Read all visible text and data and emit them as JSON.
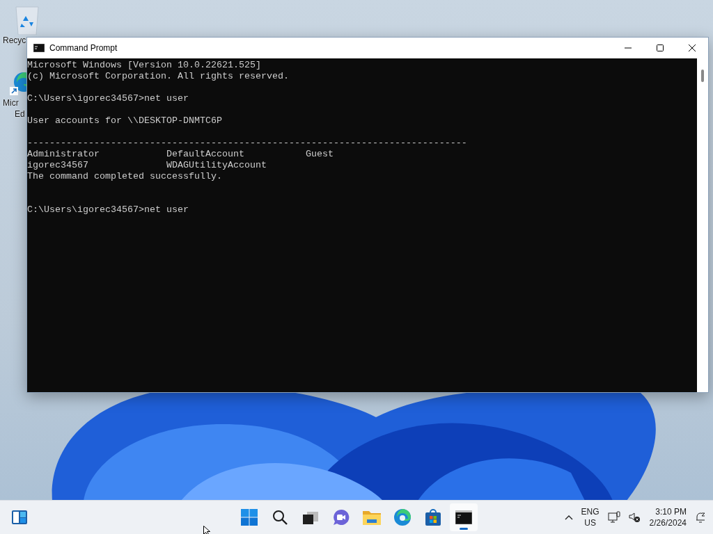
{
  "desktop_icons": [
    {
      "kind": "recycle-bin",
      "label_lines": [
        "Recyc"
      ]
    },
    {
      "kind": "edge",
      "label_lines": [
        "Micr",
        "Ed"
      ]
    }
  ],
  "window": {
    "title": "Command Prompt",
    "console_lines": [
      {
        "kind": "text",
        "text": "Microsoft Windows [Version 10.0.22621.525]"
      },
      {
        "kind": "text",
        "text": "(c) Microsoft Corporation. All rights reserved."
      },
      {
        "kind": "blank"
      },
      {
        "kind": "text",
        "text": "C:\\Users\\igorec34567>net user"
      },
      {
        "kind": "blank"
      },
      {
        "kind": "text",
        "text": "User accounts for \\\\DESKTOP-DNMTC6P"
      },
      {
        "kind": "blank"
      },
      {
        "kind": "text",
        "text": "-------------------------------------------------------------------------------"
      },
      {
        "kind": "text",
        "text": "Administrator            DefaultAccount           Guest"
      },
      {
        "kind": "text",
        "text": "igorec34567              WDAGUtilityAccount"
      },
      {
        "kind": "text",
        "text": "The command completed successfully."
      },
      {
        "kind": "blank"
      },
      {
        "kind": "blank"
      },
      {
        "kind": "text",
        "text": "C:\\Users\\igorec34567>net user"
      }
    ]
  },
  "taskbar": {
    "widgets": {
      "kind": "widgets"
    },
    "apps": [
      {
        "kind": "start",
        "active": false
      },
      {
        "kind": "search",
        "active": false
      },
      {
        "kind": "task-view",
        "active": false
      },
      {
        "kind": "chat",
        "active": false
      },
      {
        "kind": "file-explorer",
        "active": false
      },
      {
        "kind": "edge",
        "active": false
      },
      {
        "kind": "store",
        "active": false
      },
      {
        "kind": "terminal",
        "active": true
      }
    ],
    "language": [
      "ENG",
      "US"
    ],
    "clock": {
      "time": "3:10 PM",
      "date": "2/26/2024"
    }
  }
}
